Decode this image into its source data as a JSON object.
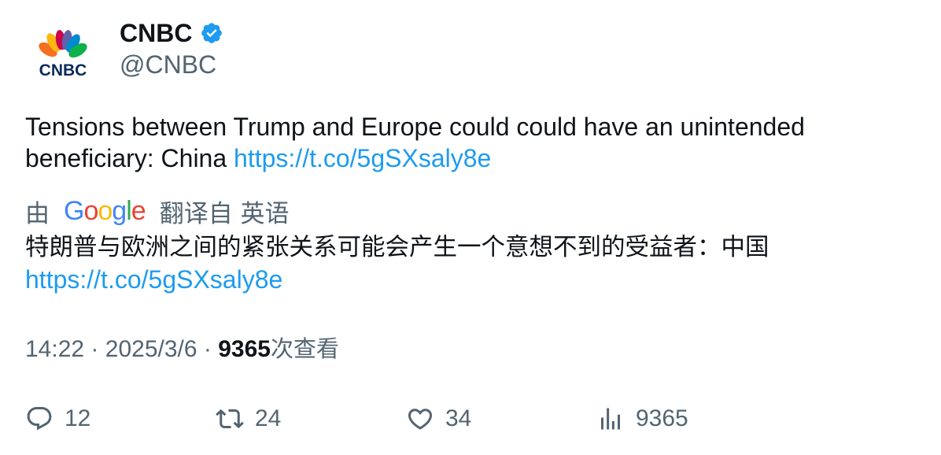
{
  "author": {
    "display_name": "CNBC",
    "handle": "@CNBC",
    "verified": true,
    "avatar_icon": "cnbc-peacock-logo"
  },
  "tweet": {
    "text": "Tensions between Trump and Europe could could have an unintended beneficiary: China",
    "link": "https://t.co/5gSXsaly8e"
  },
  "translation": {
    "by_label": "由",
    "provider": "Google",
    "from_label": "翻译自 英语",
    "text": "特朗普与欧洲之间的紧张关系可能会产生一个意想不到的受益者：中国",
    "link": "https://t.co/5gSXsaly8e"
  },
  "meta": {
    "time": "14:22",
    "separator": "·",
    "date": "2025/3/6",
    "views_count": "9365",
    "views_label": "次查看"
  },
  "actions": {
    "replies": "12",
    "retweets": "24",
    "likes": "34",
    "views": "9365"
  },
  "colors": {
    "text": "#0f1419",
    "secondary": "#536471",
    "link": "#1d9bf0",
    "verified": "#1d9bf0"
  }
}
